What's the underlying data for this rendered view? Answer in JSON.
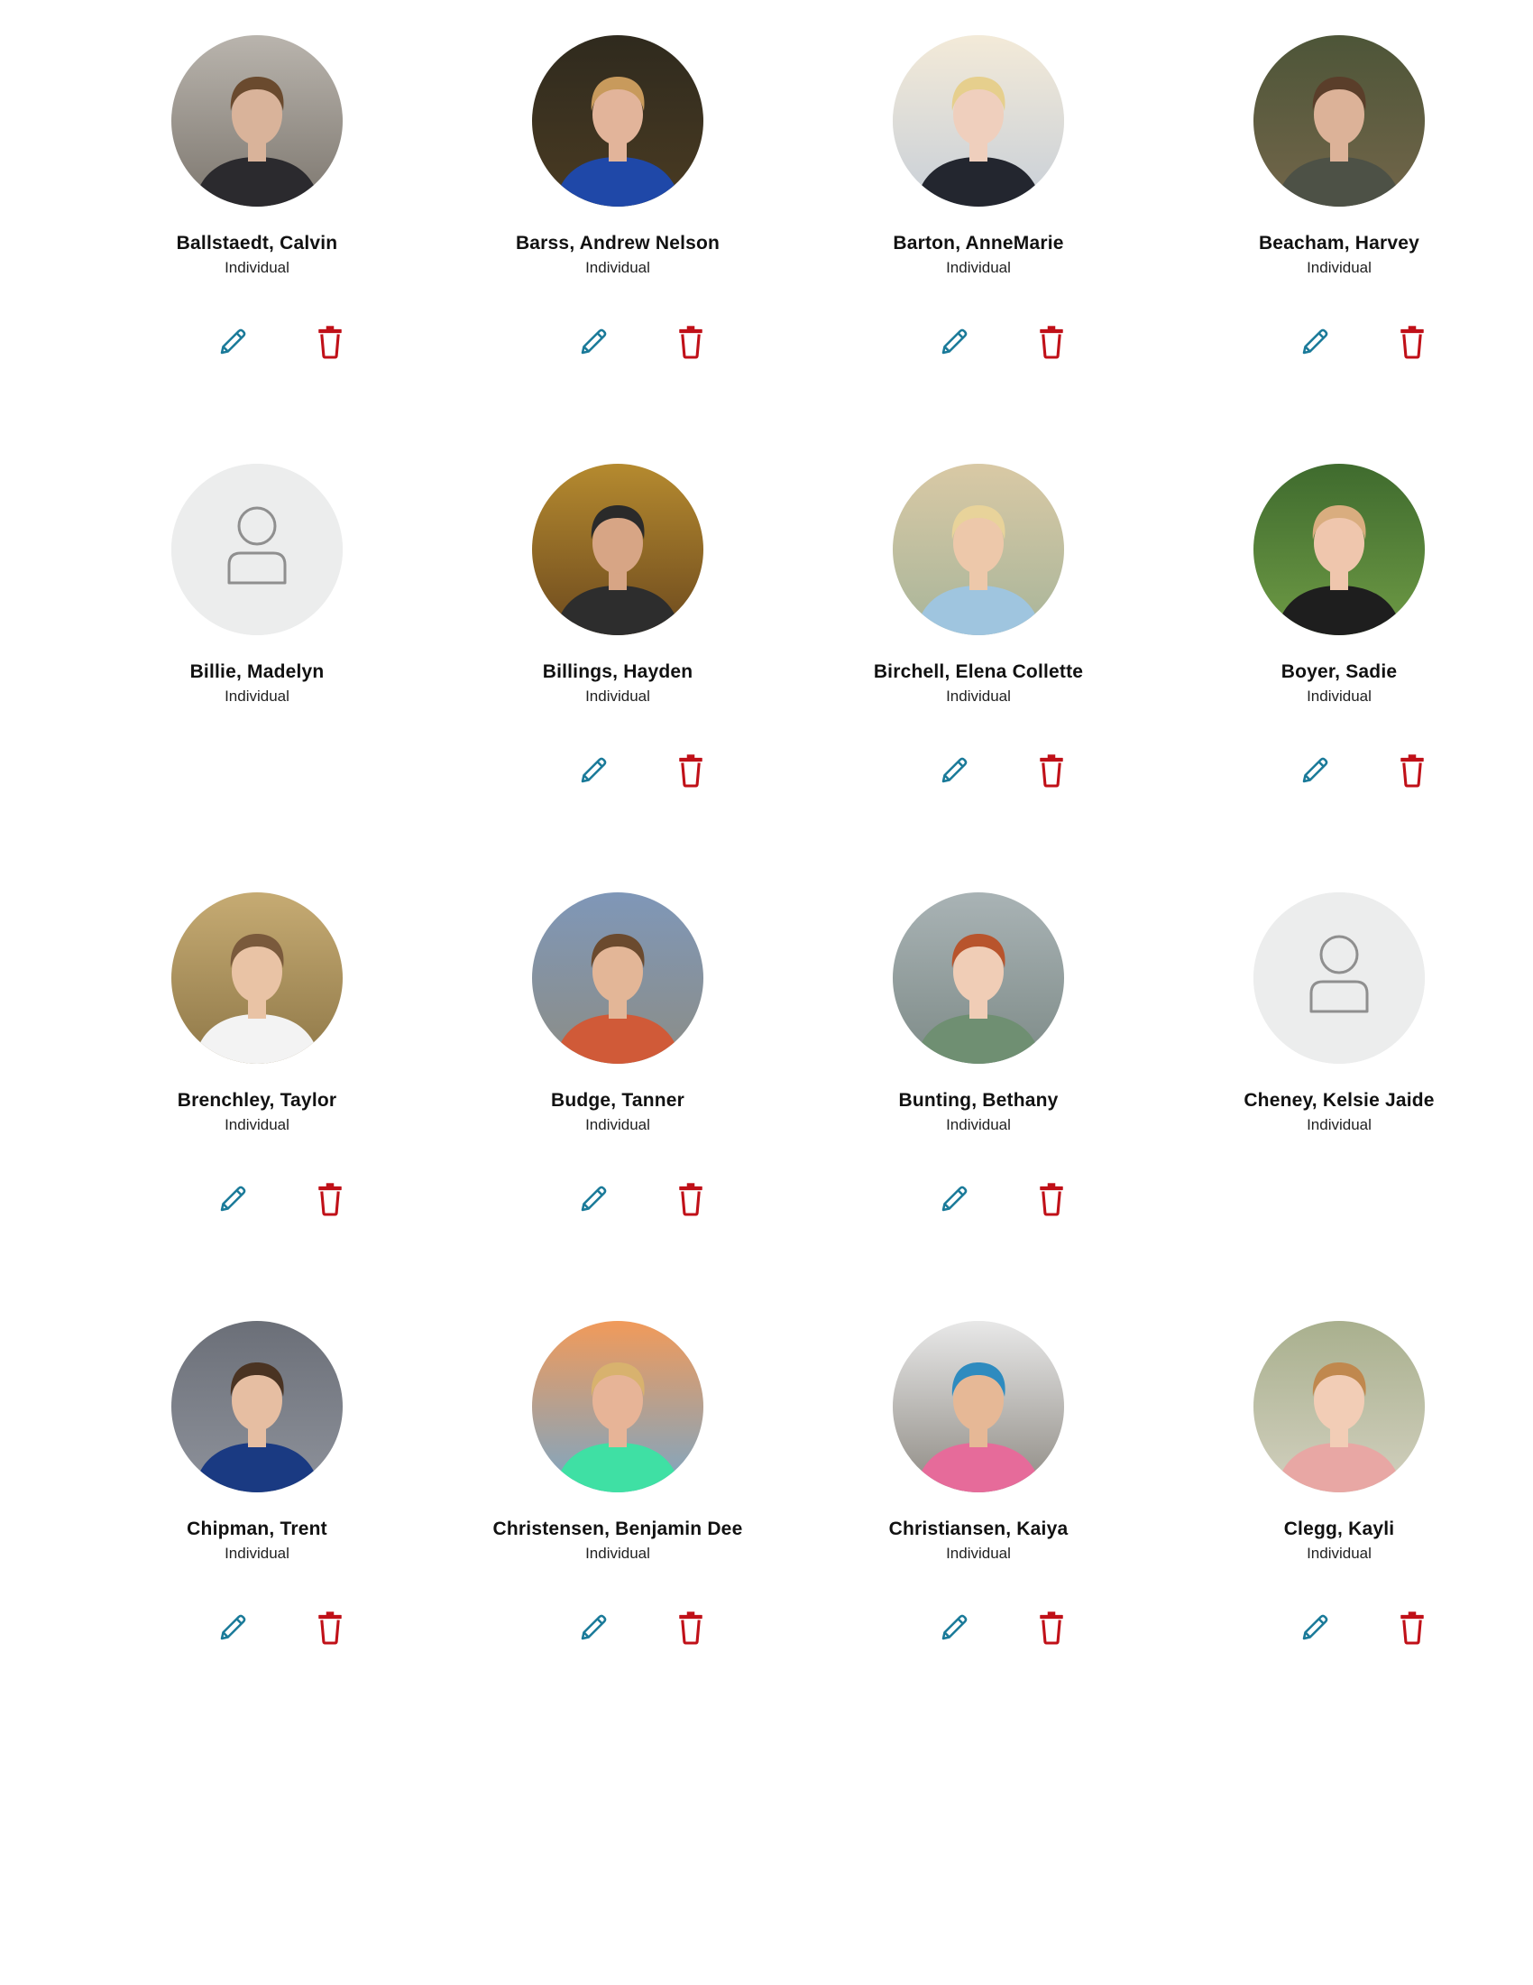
{
  "colors": {
    "edit": "#1a7a99",
    "delete": "#c01018",
    "placeholder_bg": "#eceded",
    "placeholder_icon": "#8f8f8f"
  },
  "icons": {
    "edit": "pencil-icon",
    "delete": "trash-icon",
    "placeholder": "person-icon"
  },
  "people": [
    {
      "name": "Ballstaedt, Calvin",
      "role": "Individual",
      "has_photo": true,
      "has_actions": true
    },
    {
      "name": "Barss, Andrew Nelson",
      "role": "Individual",
      "has_photo": true,
      "has_actions": true
    },
    {
      "name": "Barton, AnneMarie",
      "role": "Individual",
      "has_photo": true,
      "has_actions": true
    },
    {
      "name": "Beacham, Harvey",
      "role": "Individual",
      "has_photo": true,
      "has_actions": true
    },
    {
      "name": "Billie, Madelyn",
      "role": "Individual",
      "has_photo": false,
      "has_actions": false
    },
    {
      "name": "Billings, Hayden",
      "role": "Individual",
      "has_photo": true,
      "has_actions": true
    },
    {
      "name": "Birchell, Elena Collette",
      "role": "Individual",
      "has_photo": true,
      "has_actions": true
    },
    {
      "name": "Boyer, Sadie",
      "role": "Individual",
      "has_photo": true,
      "has_actions": true
    },
    {
      "name": "Brenchley, Taylor",
      "role": "Individual",
      "has_photo": true,
      "has_actions": true
    },
    {
      "name": "Budge, Tanner",
      "role": "Individual",
      "has_photo": true,
      "has_actions": true
    },
    {
      "name": "Bunting, Bethany",
      "role": "Individual",
      "has_photo": true,
      "has_actions": true
    },
    {
      "name": "Cheney, Kelsie Jaide",
      "role": "Individual",
      "has_photo": false,
      "has_actions": false
    },
    {
      "name": "Chipman, Trent",
      "role": "Individual",
      "has_photo": true,
      "has_actions": true
    },
    {
      "name": "Christensen, Benjamin Dee",
      "role": "Individual",
      "has_photo": true,
      "has_actions": true
    },
    {
      "name": "Christiansen, Kaiya",
      "role": "Individual",
      "has_photo": true,
      "has_actions": true
    },
    {
      "name": "Clegg, Kayli",
      "role": "Individual",
      "has_photo": true,
      "has_actions": true
    }
  ]
}
